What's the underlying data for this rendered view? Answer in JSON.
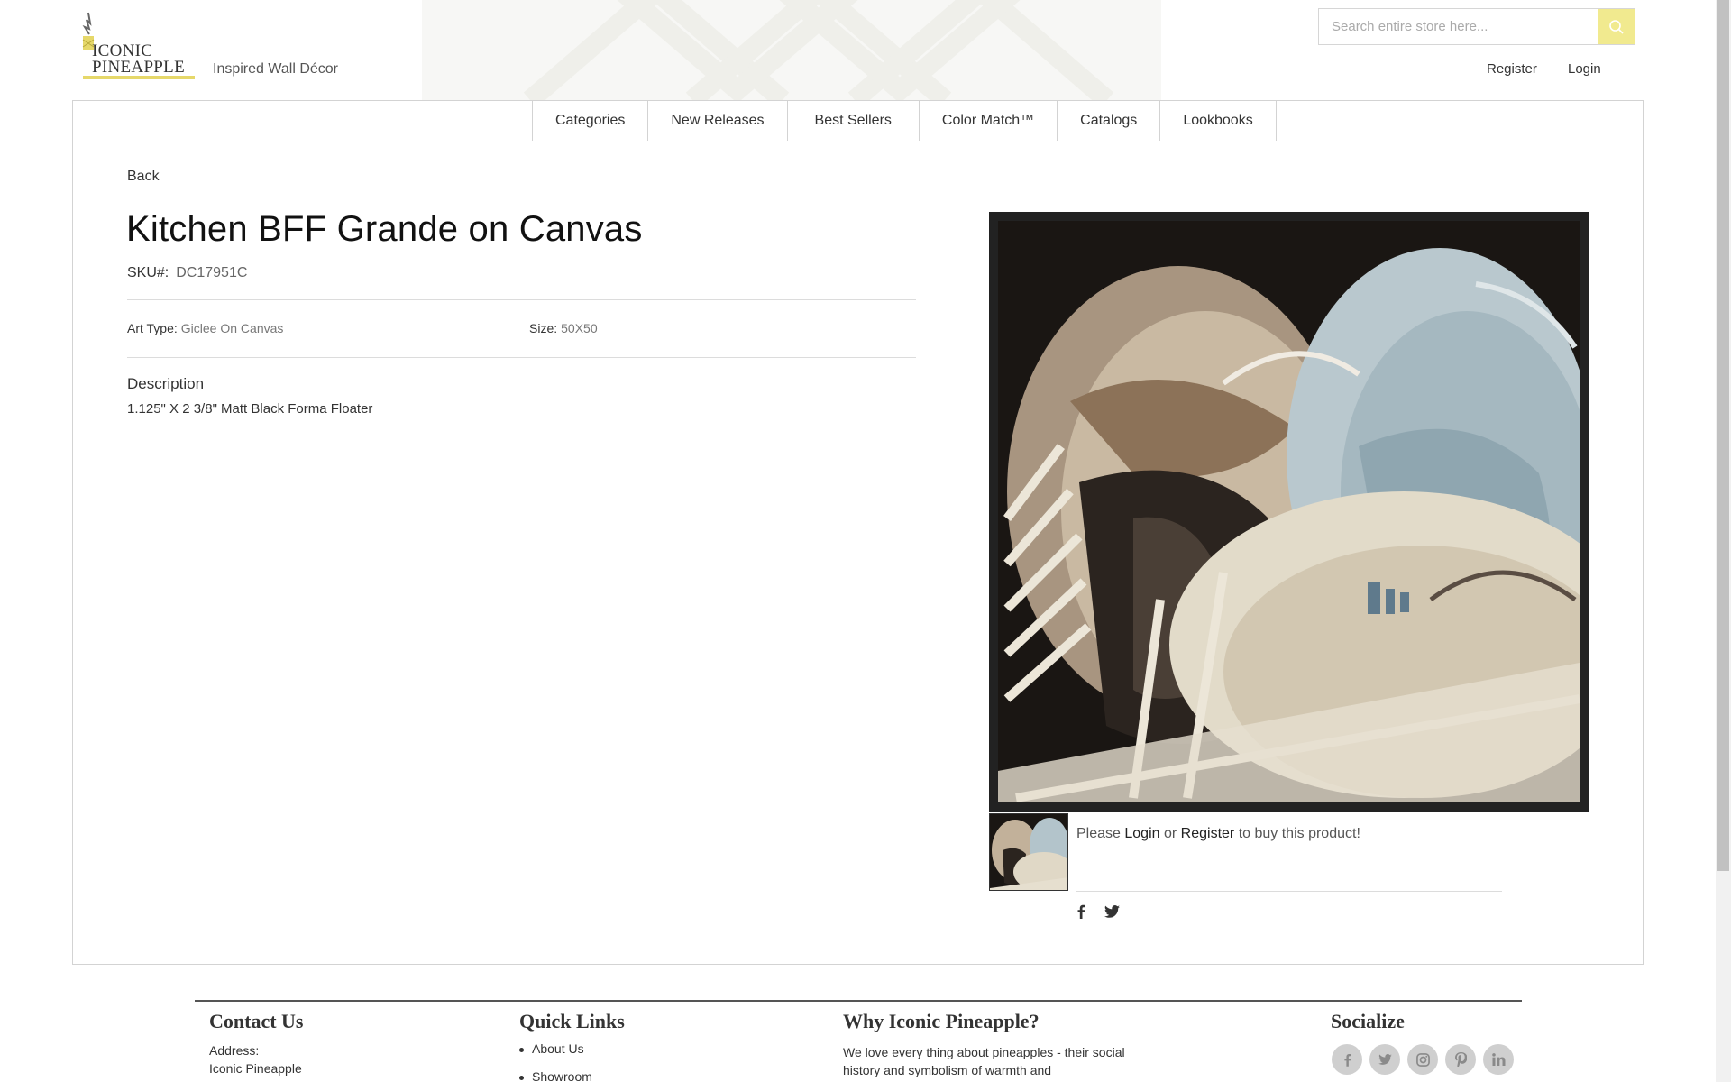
{
  "header": {
    "logo_text_line1": "ICONIC",
    "logo_text_line2": "PINEAPPLE",
    "tagline": "Inspired Wall Décor",
    "search_placeholder": "Search entire store here...",
    "register_label": "Register",
    "login_label": "Login"
  },
  "nav": {
    "items": [
      "Categories",
      "New Releases",
      "Best Sellers",
      "Color Match™",
      "Catalogs",
      "Lookbooks"
    ]
  },
  "product": {
    "back_label": "Back",
    "title": "Kitchen BFF Grande on Canvas",
    "sku_label": "SKU#:",
    "sku_value": "DC17951C",
    "art_type_label": "Art Type:",
    "art_type_value": "Giclee On Canvas",
    "size_label": "Size:",
    "size_value": "50X50",
    "description_heading": "Description",
    "description_text": "1.125\" X 2 3/8\" Matt Black Forma Floater",
    "buy_prefix": "Please",
    "buy_login": "Login",
    "buy_or": "or",
    "buy_register": "Register",
    "buy_suffix": "to buy this product!"
  },
  "footer": {
    "contact_heading": "Contact Us",
    "address_label": "Address:",
    "address_line1": "Iconic Pineapple",
    "quick_links_heading": "Quick Links",
    "quick_links": [
      "About Us",
      "Showroom"
    ],
    "why_heading": "Why Iconic Pineapple?",
    "why_text": "We love every thing about pineapples - their social history and symbolism of warmth and",
    "socialize_heading": "Socialize"
  },
  "icons": {
    "search": "search-icon",
    "share": [
      "facebook-icon",
      "twitter-icon"
    ],
    "social": [
      "facebook-icon",
      "twitter-icon",
      "instagram-icon",
      "pinterest-icon",
      "linkedin-icon"
    ]
  },
  "colors": {
    "accent": "#f1ea8f",
    "logo_bar": "#e6d86a"
  }
}
